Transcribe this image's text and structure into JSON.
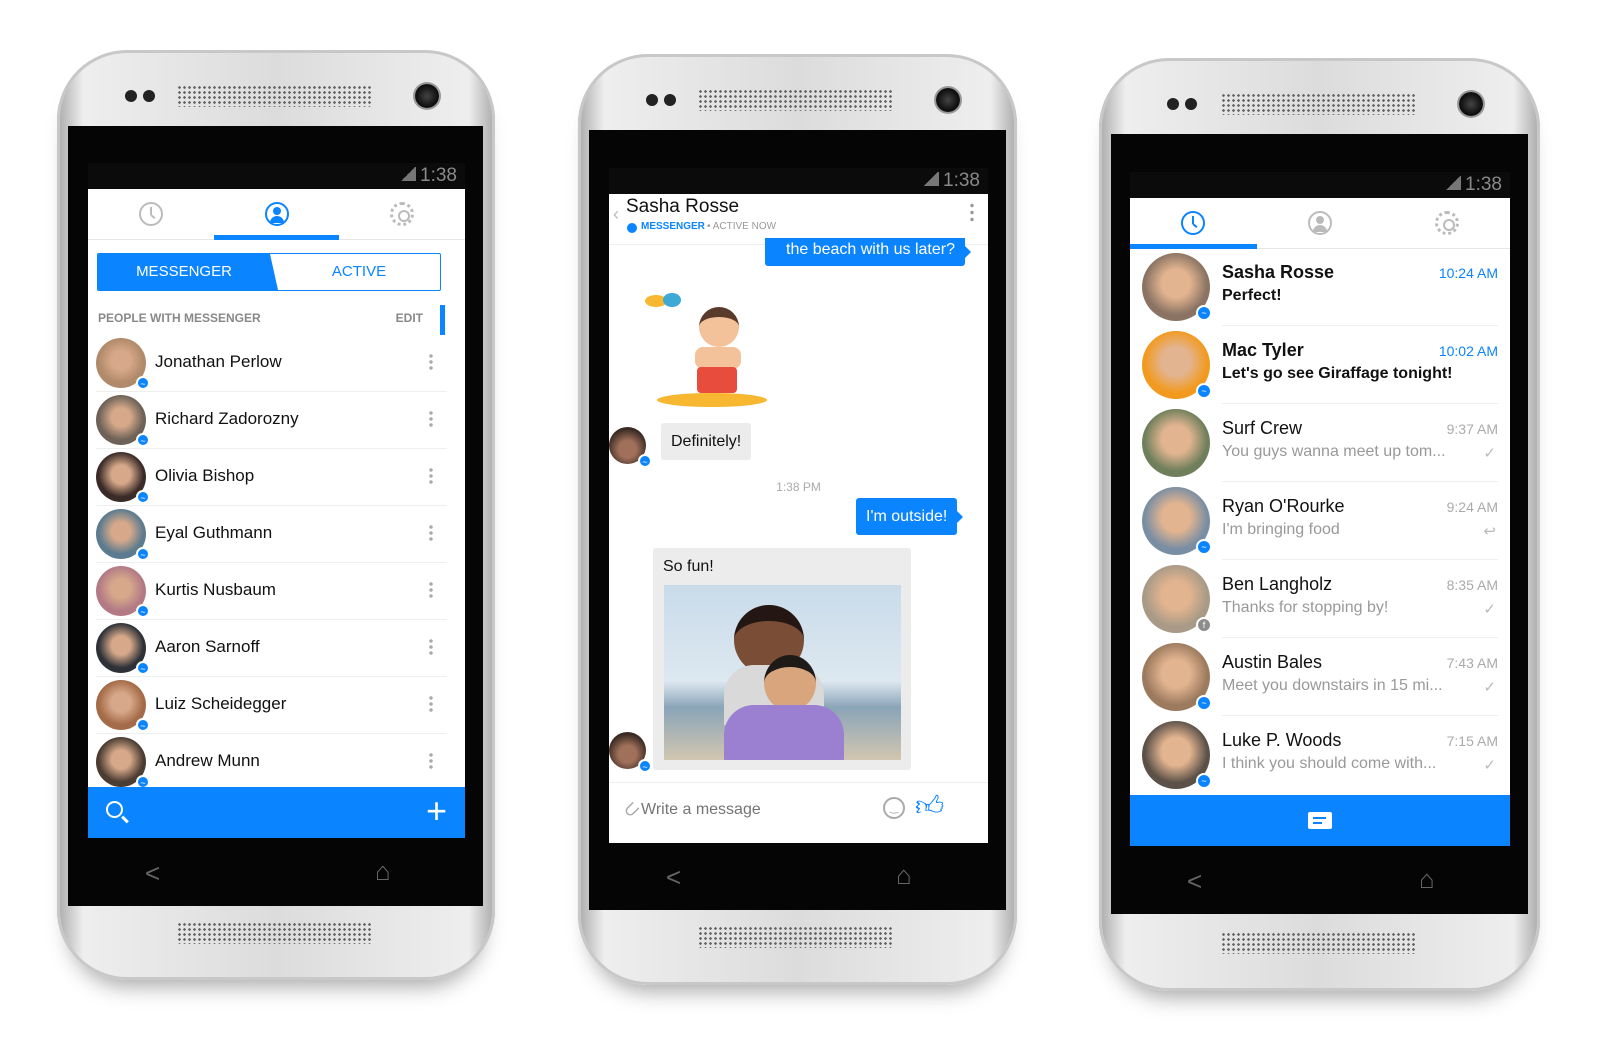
{
  "status_time": "1:38",
  "colors": {
    "accent": "#0a84ff"
  },
  "people_screen": {
    "segments": {
      "left": "MESSENGER",
      "right": "ACTIVE",
      "selected": "MESSENGER"
    },
    "section_header": "PEOPLE WITH MESSENGER",
    "edit_label": "EDIT",
    "active_tab": "people",
    "contacts": [
      {
        "name": "Jonathan Perlow",
        "color": "#b08a6a"
      },
      {
        "name": "Richard Zadorozny",
        "color": "#6e6258"
      },
      {
        "name": "Olivia Bishop",
        "color": "#3b2b28"
      },
      {
        "name": "Eyal Guthmann",
        "color": "#5c7b8e"
      },
      {
        "name": "Kurtis Nusbaum",
        "color": "#b37a86"
      },
      {
        "name": "Aaron Sarnoff",
        "color": "#2e3238"
      },
      {
        "name": "Luiz Scheidegger",
        "color": "#a46b48"
      },
      {
        "name": "Andrew Munn",
        "color": "#4c3d33"
      }
    ],
    "bottom_bar": {
      "left_icon": "search-icon",
      "right_icon": "plus-icon"
    }
  },
  "chat_screen": {
    "contact_name": "Sasha Rosse",
    "source_label": "MESSENGER",
    "presence": "• ACTIVE NOW",
    "messages": {
      "m1": "the beach with us later?",
      "m2": "Definitely!",
      "timestamp": "1:38 PM",
      "m3": "I'm outside!",
      "m4": "So fun!"
    },
    "input_placeholder": "Write a message"
  },
  "recent_screen": {
    "active_tab": "recent",
    "conversations": [
      {
        "name": "Sasha Rosse",
        "time": "10:24 AM",
        "preview": "Perfect!",
        "unread": true,
        "status": "",
        "badge": "messenger",
        "color": "#8a7363"
      },
      {
        "name": "Mac Tyler",
        "time": "10:02 AM",
        "preview": "Let's go see Giraffage tonight!",
        "unread": true,
        "status": "",
        "badge": "messenger",
        "color": "#f29a1f"
      },
      {
        "name": "Surf Crew",
        "time": "9:37 AM",
        "preview": "You guys wanna meet up tom...",
        "unread": false,
        "status": "✓",
        "badge": "",
        "color": "#6f7f5c"
      },
      {
        "name": "Ryan O'Rourke",
        "time": "9:24 AM",
        "preview": "I'm bringing food",
        "unread": false,
        "status": "↩",
        "badge": "messenger",
        "color": "#7a8ea3"
      },
      {
        "name": "Ben Langholz",
        "time": "8:35 AM",
        "preview": "Thanks for stopping by!",
        "unread": false,
        "status": "✓",
        "badge": "facebook",
        "color": "#a89a86"
      },
      {
        "name": "Austin Bales",
        "time": "7:43 AM",
        "preview": "Meet you downstairs in 15 mi...",
        "unread": false,
        "status": "✓",
        "badge": "messenger",
        "color": "#9c7a5e"
      },
      {
        "name": "Luke P. Woods",
        "time": "7:15 AM",
        "preview": "I think you should come with...",
        "unread": false,
        "status": "✓",
        "badge": "messenger",
        "color": "#5b5148"
      }
    ],
    "bottom_bar": {
      "icon": "compose-message-icon"
    }
  }
}
